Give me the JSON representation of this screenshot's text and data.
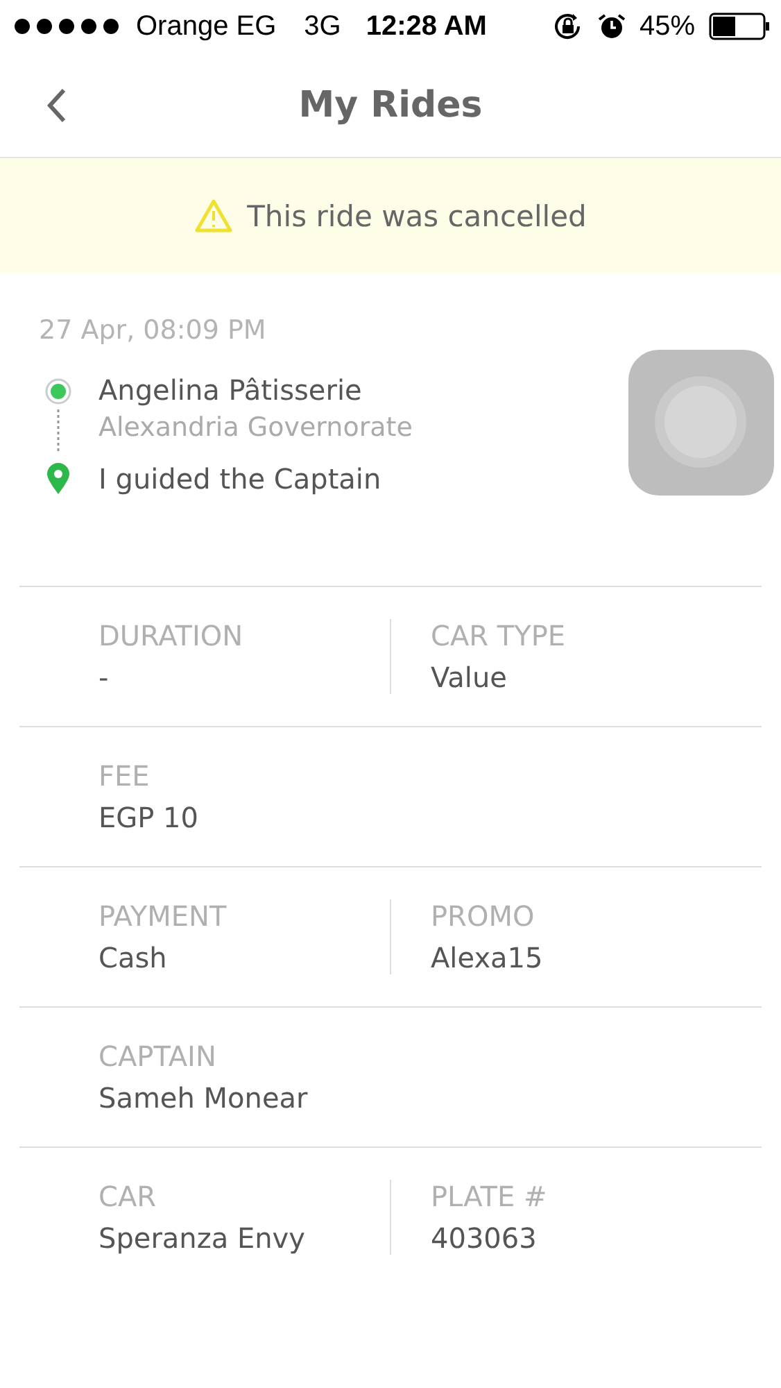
{
  "status_bar": {
    "carrier": "Orange EG",
    "network": "3G",
    "time": "12:28 AM",
    "battery": "45%"
  },
  "nav": {
    "title": "My Rides"
  },
  "banner": {
    "text": "This ride was cancelled"
  },
  "ride": {
    "date": "27 Apr, 08:09 PM",
    "pickup": {
      "name": "Angelina Pâtisserie",
      "area": "Alexandria Governorate"
    },
    "dropoff": {
      "name": "I guided the Captain"
    }
  },
  "details": [
    {
      "fields": [
        {
          "label": "DURATION",
          "value": "-"
        },
        {
          "label": "CAR TYPE",
          "value": "Value"
        }
      ]
    },
    {
      "fields": [
        {
          "label": "FEE",
          "value": "EGP 10"
        }
      ]
    },
    {
      "fields": [
        {
          "label": "PAYMENT",
          "value": "Cash"
        },
        {
          "label": "PROMO",
          "value": "Alexa15"
        }
      ]
    },
    {
      "fields": [
        {
          "label": "CAPTAIN",
          "value": "Sameh Monear"
        }
      ]
    },
    {
      "fields": [
        {
          "label": "CAR",
          "value": "Speranza Envy"
        },
        {
          "label": "PLATE #",
          "value": "403063"
        }
      ]
    }
  ]
}
